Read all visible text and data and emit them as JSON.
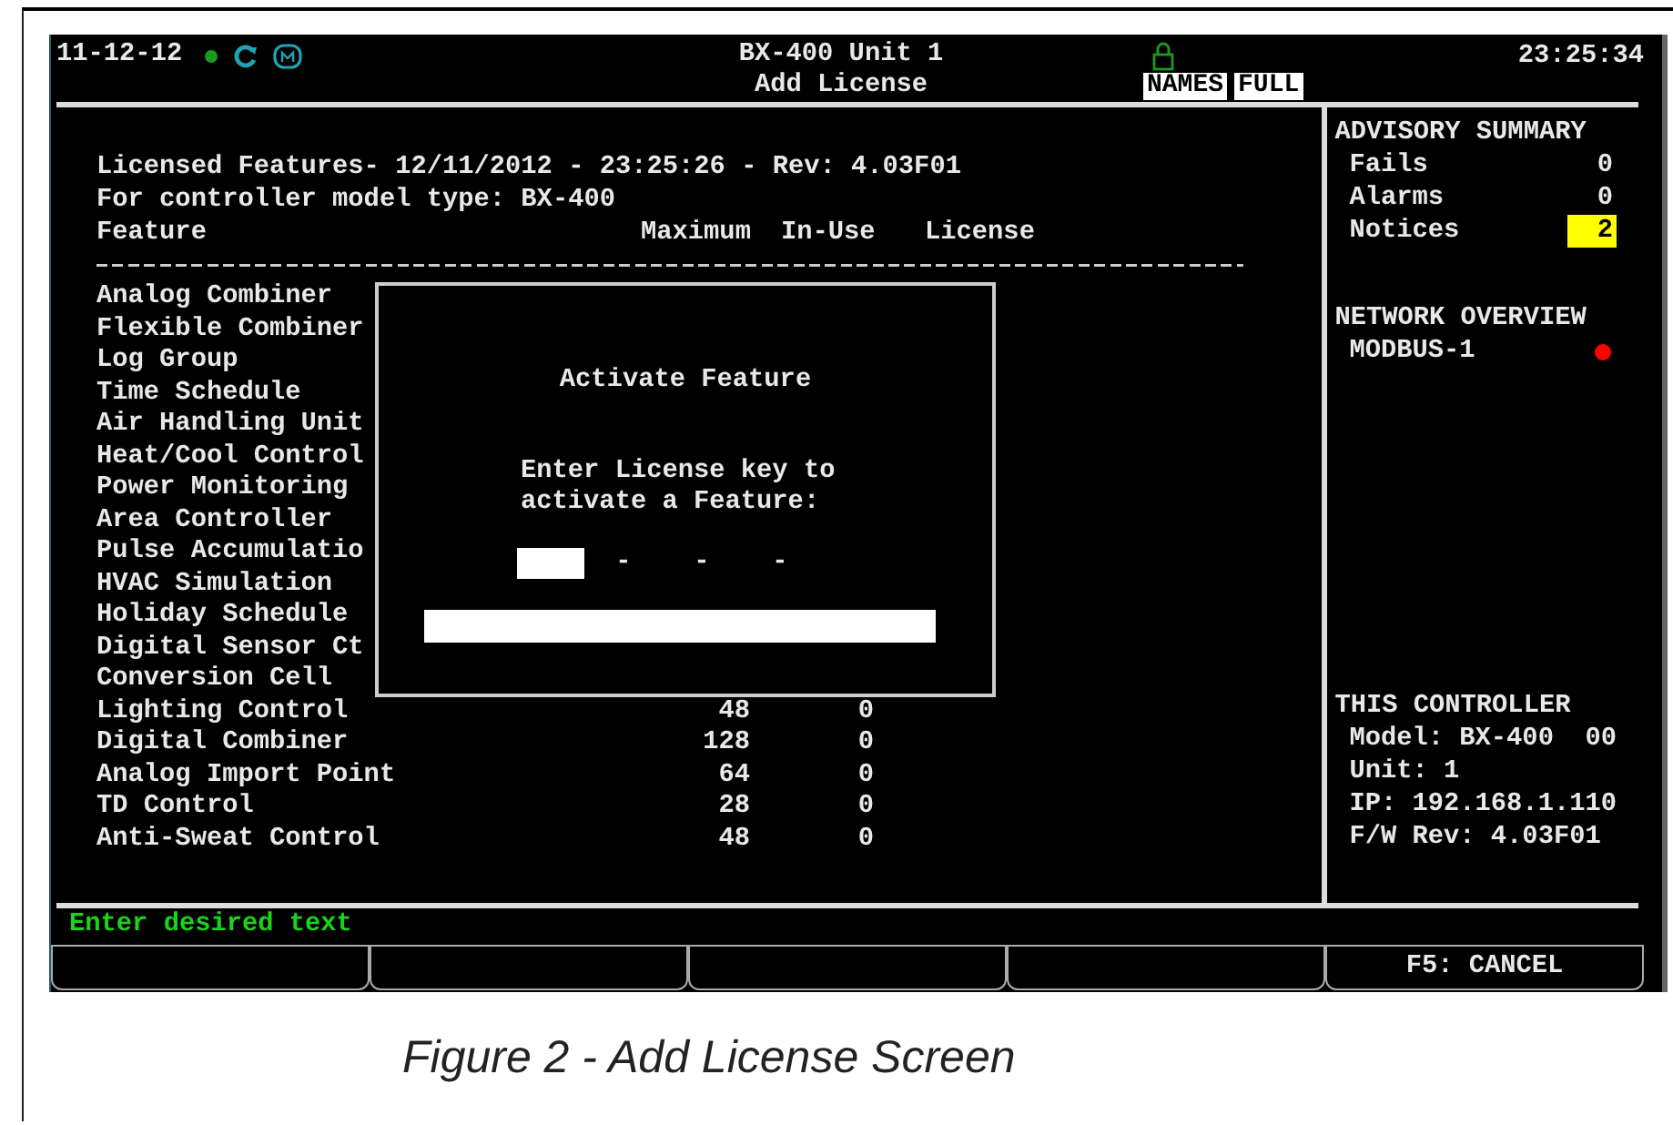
{
  "header": {
    "date": "11-12-12",
    "controller": "BX-400 Unit 1",
    "screen_title": "Add License",
    "time": "23:25:34",
    "mode_tags": [
      "NAMES",
      "FULL"
    ]
  },
  "licenses": {
    "title": "Licensed Features- 12/11/2012 - 23:25:26 - Rev: 4.03F01",
    "model_line": "For controller model type: BX-400",
    "columns": [
      "Feature",
      "Maximum",
      "In-Use",
      "License"
    ],
    "rows": [
      {
        "feature": "Analog Combiner"
      },
      {
        "feature": "Flexible Combiner"
      },
      {
        "feature": "Log Group"
      },
      {
        "feature": "Time Schedule"
      },
      {
        "feature": "Air Handling Unit"
      },
      {
        "feature": "Heat/Cool Control"
      },
      {
        "feature": "Power Monitoring"
      },
      {
        "feature": "Area Controller"
      },
      {
        "feature": "Pulse Accumulatio"
      },
      {
        "feature": "HVAC Simulation"
      },
      {
        "feature": "Holiday Schedule"
      },
      {
        "feature": "Digital Sensor Ct"
      },
      {
        "feature": "Conversion Cell"
      },
      {
        "feature": "Lighting Control",
        "maximum": "48",
        "in_use": "0"
      },
      {
        "feature": "Digital Combiner",
        "maximum": "128",
        "in_use": "0"
      },
      {
        "feature": "Analog Import Point",
        "maximum": "64",
        "in_use": "0"
      },
      {
        "feature": "TD Control",
        "maximum": "28",
        "in_use": "0"
      },
      {
        "feature": "Anti-Sweat Control",
        "maximum": "48",
        "in_use": "0"
      }
    ]
  },
  "dialog": {
    "title": "Activate Feature",
    "prompt_lines": [
      "Enter License key to",
      "activate a Feature:"
    ],
    "key_separators": [
      "-",
      "-",
      "-"
    ]
  },
  "sidebar": {
    "advisory": {
      "title": "ADVISORY SUMMARY",
      "items": [
        {
          "label": "Fails",
          "count": "0",
          "highlighted": false
        },
        {
          "label": "Alarms",
          "count": "0",
          "highlighted": false
        },
        {
          "label": "Notices",
          "count": "2",
          "highlighted": true
        }
      ]
    },
    "network": {
      "title": "NETWORK OVERVIEW",
      "items": [
        {
          "name": "MODBUS-1",
          "color": "#ff0000"
        }
      ]
    },
    "controller": {
      "title": "THIS CONTROLLER",
      "lines": [
        "Model: BX-400  00",
        "Unit: 1",
        "IP: 192.168.1.110",
        "F/W Rev: 4.03F01"
      ]
    }
  },
  "status_bar": "Enter desired text",
  "function_keys": [
    {
      "kind": "blank"
    },
    {
      "kind": "blank"
    },
    {
      "kind": "blank"
    },
    {
      "kind": "blank"
    },
    {
      "kind": "labeled",
      "label": "F5: CANCEL"
    }
  ],
  "caption": "Figure 2 - Add License Screen"
}
